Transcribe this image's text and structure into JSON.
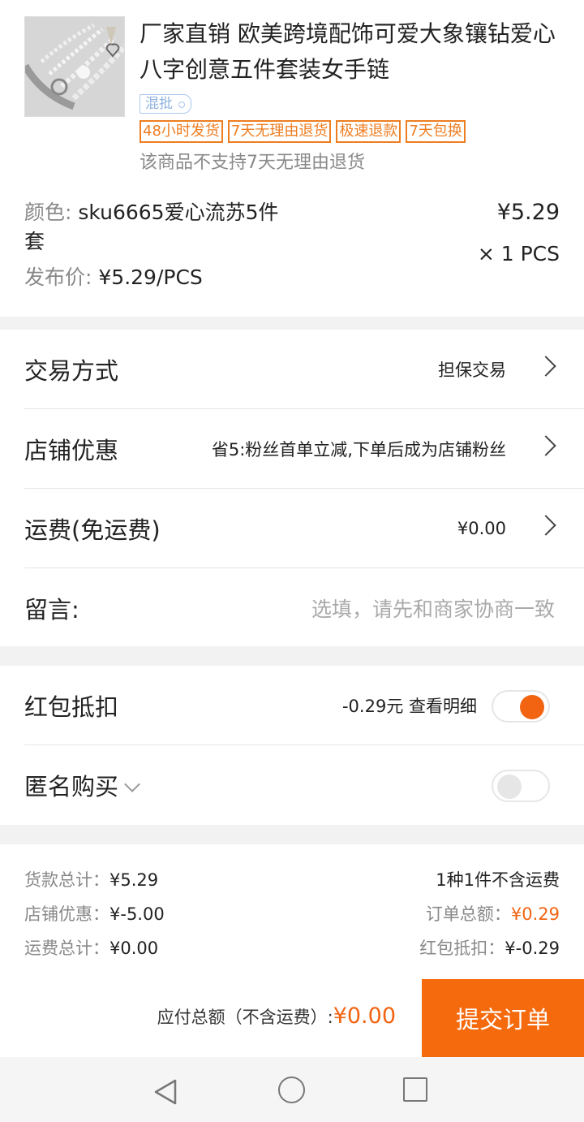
{
  "product": {
    "title": "厂家直销 欧美跨境配饰可爱大象镶钻爱心八字创意五件套装女手链",
    "mix_badge": "混批",
    "tags": [
      "48小时发货",
      "7天无理由退货",
      "极速退款",
      "7天包换"
    ],
    "notice": "该商品不支持7天无理由退货",
    "color_label": "颜色:",
    "color_value": "sku6665爱心流苏5件套",
    "pub_price_label": "发布价:",
    "pub_price_value": "¥5.29/PCS",
    "price": "¥5.29",
    "quantity": "× 1 PCS"
  },
  "options": {
    "trade_method": {
      "label": "交易方式",
      "value": "担保交易"
    },
    "shop_discount": {
      "label": "店铺优惠",
      "value": "省5:粉丝首单立减,下单后成为店铺粉丝"
    },
    "shipping": {
      "label": "运费(免运费)",
      "value": "¥0.00"
    },
    "message": {
      "label": "留言:",
      "placeholder": "选填，请先和商家协商一致"
    }
  },
  "toggles": {
    "red_packet": {
      "label": "红包抵扣",
      "value": "-0.29元  查看明细",
      "on": true
    },
    "anonymous": {
      "label": "匿名购买",
      "on": false
    }
  },
  "summary": {
    "goods_total_label": "货款总计：",
    "goods_total": "¥5.29",
    "shop_discount_label": "店铺优惠：",
    "shop_discount": "¥-5.00",
    "shipping_total_label": "运费总计：",
    "shipping_total": "¥0.00",
    "count_info": "1种1件不含运费",
    "order_total_label": "订单总额：",
    "order_total": "¥0.29",
    "red_packet_label": "红包抵扣：",
    "red_packet": "¥-0.29"
  },
  "footer": {
    "payable_label": "应付总额（不含运费）:",
    "payable_amount": "¥0.00",
    "submit_label": "提交订单"
  },
  "colors": {
    "accent": "#f26412",
    "tag": "#ee7e22",
    "badge": "#a9c7ee"
  }
}
